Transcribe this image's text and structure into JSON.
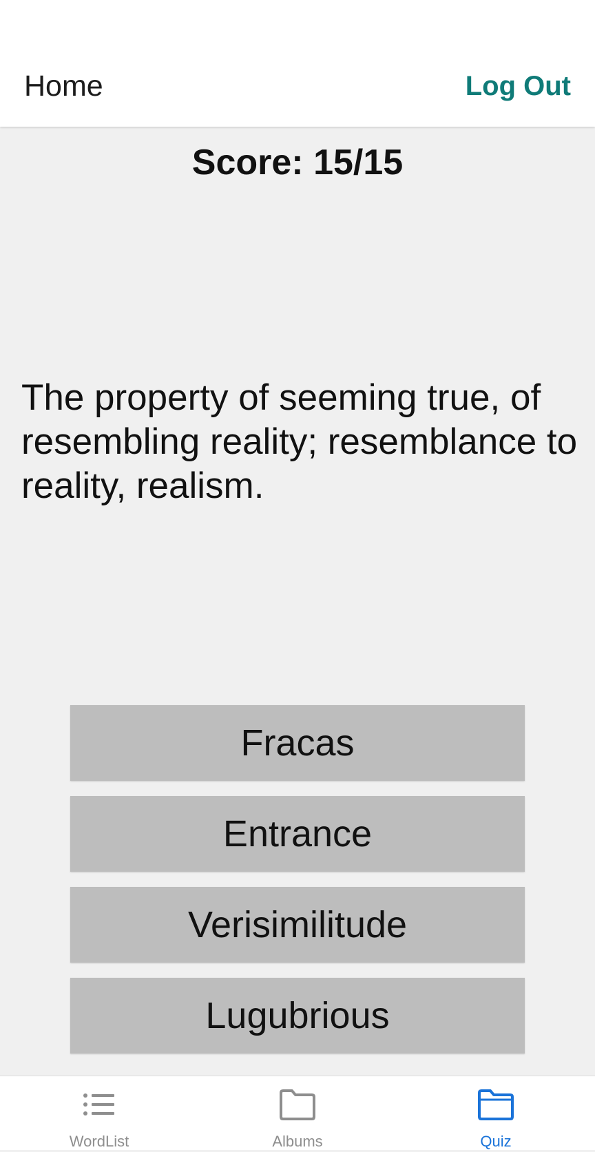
{
  "header": {
    "title": "Home",
    "logout_label": "Log Out"
  },
  "quiz": {
    "score": "Score: 15/15",
    "question": "The property of seeming true, of resembling reality; resemblance to reality, realism.",
    "answers": [
      "Fracas",
      "Entrance",
      "Verisimilitude",
      "Lugubrious"
    ]
  },
  "tabs": [
    {
      "label": "WordList",
      "icon": "list-icon",
      "active": false
    },
    {
      "label": "Albums",
      "icon": "folder-icon",
      "active": false
    },
    {
      "label": "Quiz",
      "icon": "folder-icon",
      "active": true
    }
  ],
  "colors": {
    "accent": "#0f7b78",
    "tab_active": "#1a73d9",
    "tab_inactive": "#8e8e8e",
    "button_bg": "#bdbdbd",
    "page_bg": "#f0f0f0"
  }
}
